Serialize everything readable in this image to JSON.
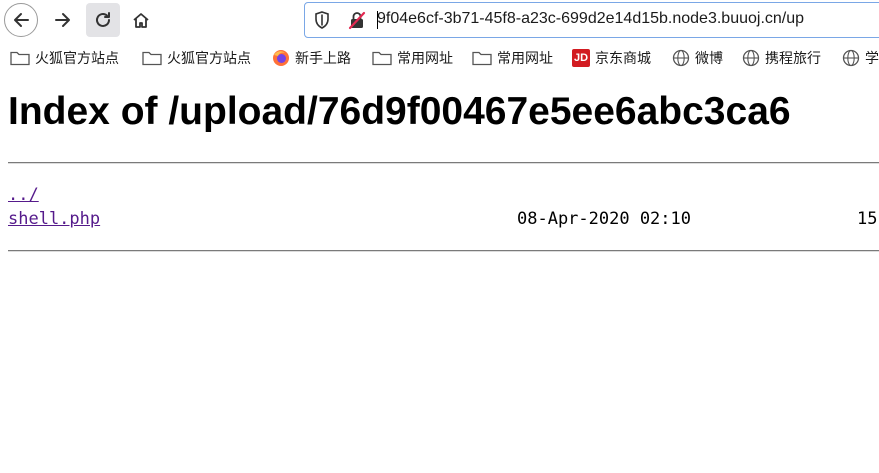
{
  "toolbar": {
    "url": "9f04e6cf-3b71-45f8-a23c-699d2e14d15b.node3.buuoj.cn/up"
  },
  "bookmarks": [
    {
      "label": "火狐官方站点",
      "icon": "folder-icon"
    },
    {
      "label": "火狐官方站点",
      "icon": "folder-icon"
    },
    {
      "label": "新手上路",
      "icon": "firefox-icon"
    },
    {
      "label": "常用网址",
      "icon": "folder-icon"
    },
    {
      "label": "常用网址",
      "icon": "folder-icon"
    },
    {
      "label": "京东商城",
      "icon": "jd-icon",
      "icon_text": "JD"
    },
    {
      "label": "微博",
      "icon": "globe-icon"
    },
    {
      "label": "携程旅行",
      "icon": "globe-icon"
    },
    {
      "label": "学",
      "icon": "globe-icon"
    }
  ],
  "page": {
    "title": "Index of /upload/76d9f00467e5ee6abc3ca6",
    "entries": [
      {
        "name": "../",
        "date": "",
        "size": ""
      },
      {
        "name": "shell.php",
        "date": "08-Apr-2020 02:10",
        "size": "15"
      }
    ]
  },
  "colors": {
    "link_visited": "#551a8b",
    "urlbar_focus": "#7aa7e6",
    "jd_red": "#d21b21"
  }
}
